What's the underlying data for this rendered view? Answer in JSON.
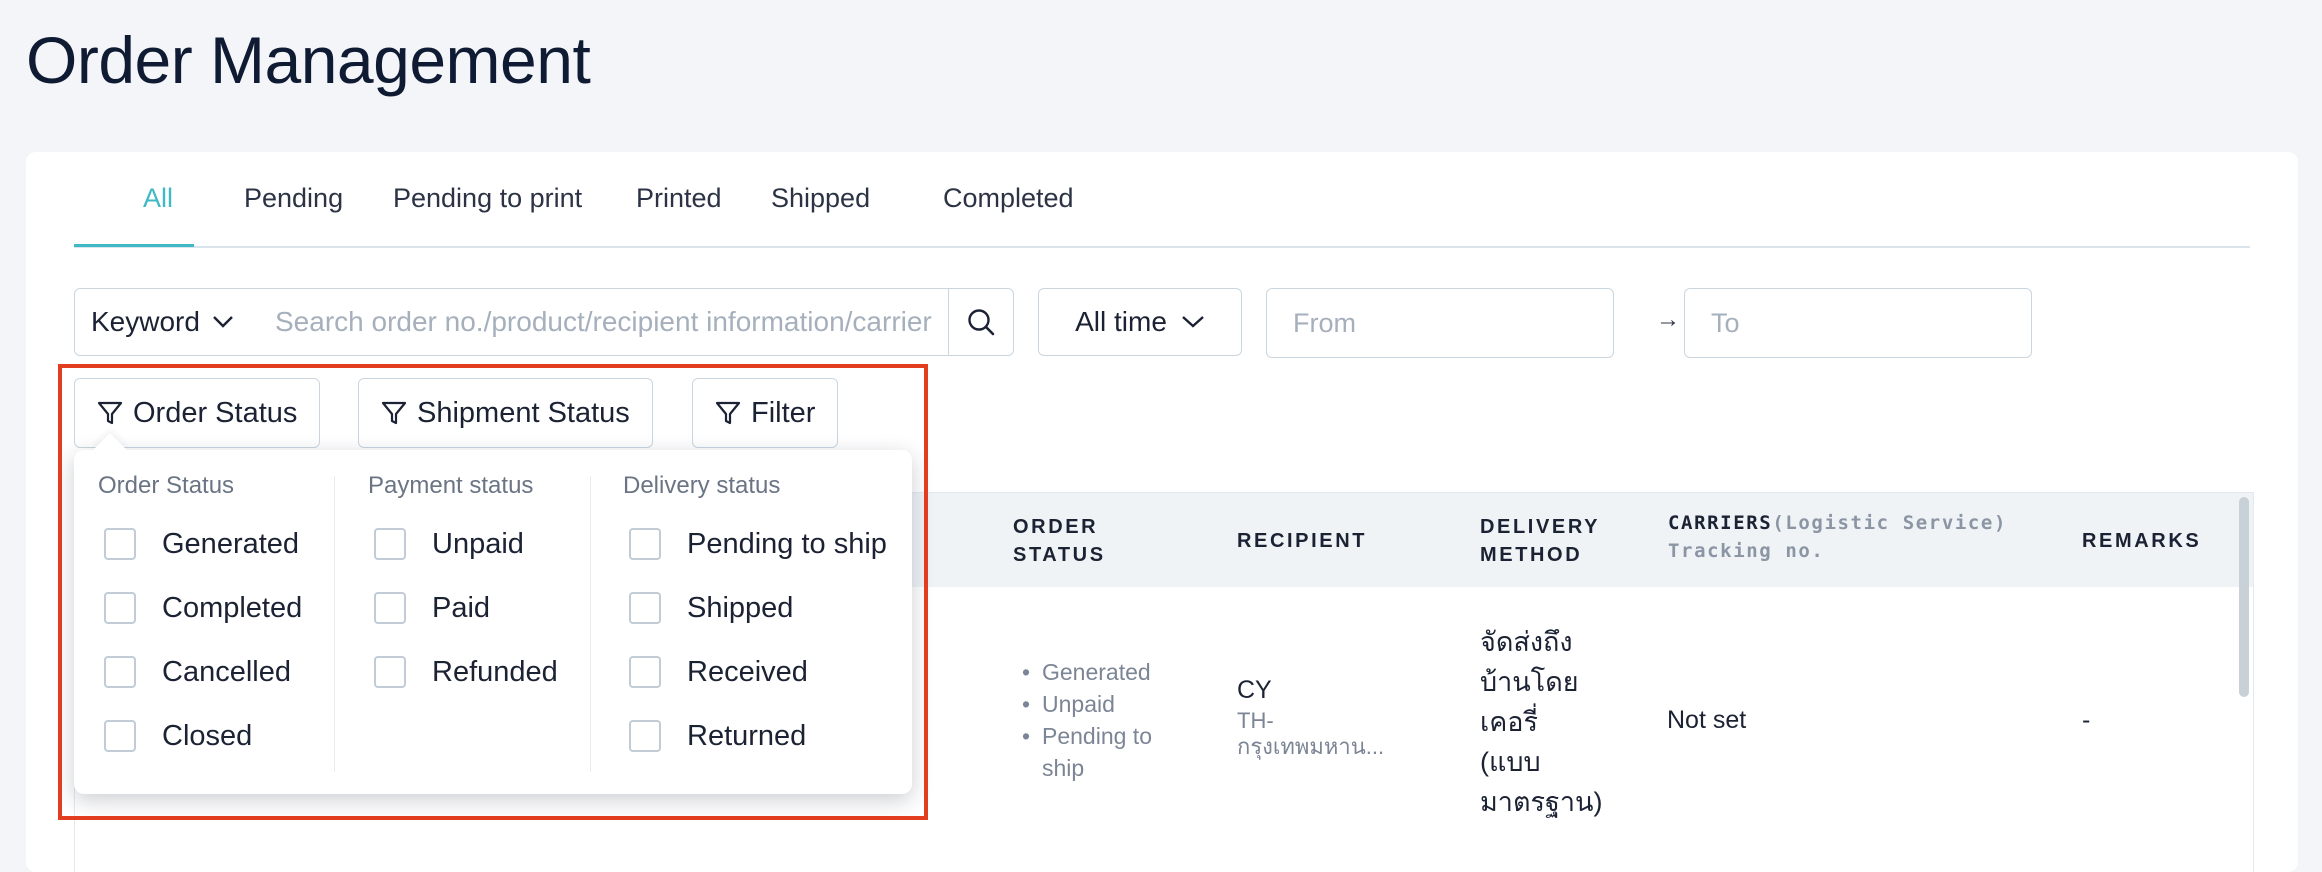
{
  "page": {
    "title": "Order Management"
  },
  "tabs": [
    {
      "label": "All",
      "active": true
    },
    {
      "label": "Pending"
    },
    {
      "label": "Pending to print"
    },
    {
      "label": "Printed"
    },
    {
      "label": "Shipped"
    },
    {
      "label": "Completed"
    }
  ],
  "search": {
    "keyword_label": "Keyword",
    "placeholder": "Search order no./product/recipient information/carrier",
    "time_label": "All time",
    "from_placeholder": "From",
    "to_placeholder": "To",
    "arrow": "→"
  },
  "filters": {
    "order_status": "Order Status",
    "shipment_status": "Shipment Status",
    "filter": "Filter"
  },
  "dropdown": {
    "columns": [
      {
        "title": "Order Status",
        "options": [
          "Generated",
          "Completed",
          "Cancelled",
          "Closed"
        ]
      },
      {
        "title": "Payment status",
        "options": [
          "Unpaid",
          "Paid",
          "Refunded"
        ]
      },
      {
        "title": "Delivery status",
        "options": [
          "Pending to ship",
          "Shipped",
          "Received",
          "Returned"
        ]
      }
    ]
  },
  "table": {
    "headers": {
      "order_status_1": "ORDER",
      "order_status_2": "STATUS",
      "recipient": "RECIPIENT",
      "delivery_1": "DELIVERY",
      "delivery_2": "METHOD",
      "carriers": "CARRIERS",
      "carriers_sub": "(Logistic Service)",
      "tracking": "Tracking no.",
      "remarks": "REMARKS"
    },
    "row": {
      "statuses": [
        "Generated",
        "Unpaid",
        "Pending to",
        "ship"
      ],
      "recipient_name": "CY",
      "recipient_addr_1": "TH-",
      "recipient_addr_2": "กรุงเทพมหาน...",
      "delivery_lines": [
        "จัดส่งถึง",
        "บ้านโดย",
        "เคอรี่",
        "(แบบ",
        "มาตรฐาน)"
      ],
      "carrier": "Not set",
      "remarks": "-"
    }
  },
  "colors": {
    "accent": "#3fb9c4",
    "highlight": "#e23d1e"
  }
}
